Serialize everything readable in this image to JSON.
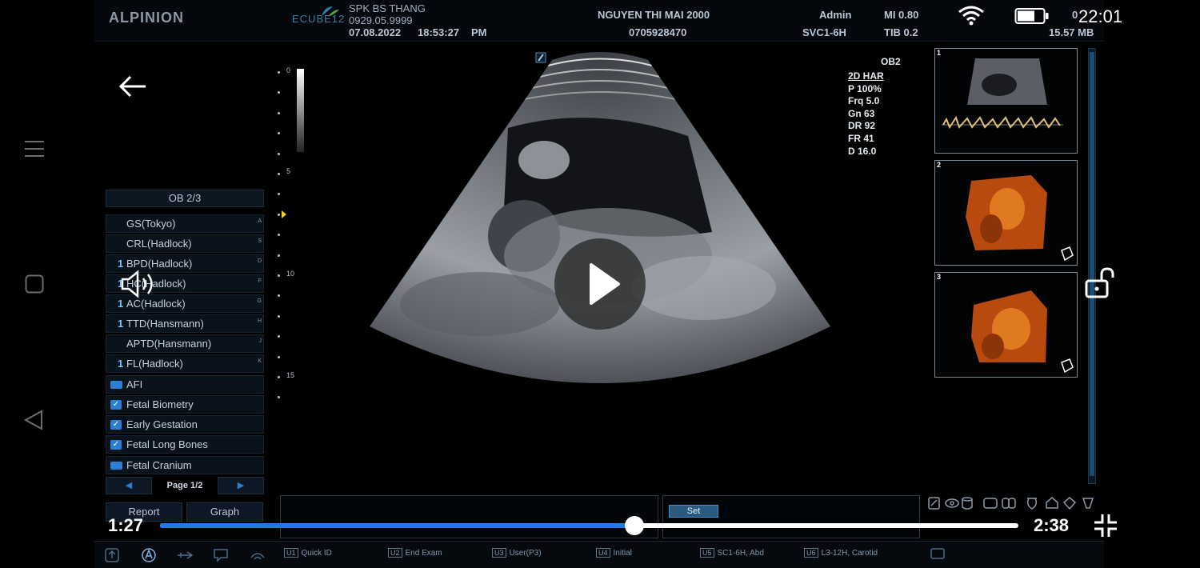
{
  "device": {
    "clock": "22:01"
  },
  "header": {
    "logo": "ALPINION",
    "ecube": "ECUBE12",
    "clinic": "SPK BS THANG",
    "phone": "0929.05.9999",
    "date": "07.08.2022",
    "time": "18:53:27",
    "ampm": "PM",
    "patient_name": "NGUYEN THI MAI 2000",
    "patient_id": "0705928470",
    "user": "Admin",
    "probe": "SVC1-6H",
    "mi": "MI 0.80",
    "tib": "TIB 0.2",
    "storage_top": "0",
    "storage": "15.57 MB"
  },
  "ob_panel": {
    "title": "OB 2/3",
    "measurements": [
      {
        "num": "",
        "label": "GS(Tokyo)",
        "key": "A"
      },
      {
        "num": "",
        "label": "CRL(Hadlock)",
        "key": "S"
      },
      {
        "num": "1",
        "label": "BPD(Hadlock)",
        "key": "D"
      },
      {
        "num": "1",
        "label": "HC(Hadlock)",
        "key": "F"
      },
      {
        "num": "1",
        "label": "AC(Hadlock)",
        "key": "G"
      },
      {
        "num": "1",
        "label": "TTD(Hansmann)",
        "key": "H"
      },
      {
        "num": "",
        "label": "APTD(Hansmann)",
        "key": "J"
      },
      {
        "num": "1",
        "label": "FL(Hadlock)",
        "key": "K"
      }
    ],
    "groups": [
      {
        "label": "AFI",
        "type": "folder"
      },
      {
        "label": "Fetal Biometry",
        "type": "check"
      },
      {
        "label": "Early Gestation",
        "type": "check"
      },
      {
        "label": "Fetal Long Bones",
        "type": "check"
      },
      {
        "label": "Fetal Cranium",
        "type": "folder"
      }
    ],
    "page": "Page 1/2",
    "report_label": "Report",
    "graph_label": "Graph"
  },
  "scale": {
    "labels": [
      "0",
      "5",
      "10",
      "15"
    ]
  },
  "image_params": {
    "preset": "OB2",
    "mode": "2D HAR",
    "power": "P 100%",
    "freq": "Frq 5.0",
    "gain": "Gn 63",
    "dr": "DR 92",
    "fr": "FR 41",
    "depth": "D 16.0"
  },
  "thumbnails": [
    "1",
    "2",
    "3"
  ],
  "bottom": {
    "set_label": "Set",
    "function_keys": [
      {
        "key": "U1",
        "label": "Quick ID"
      },
      {
        "key": "U2",
        "label": "End Exam"
      },
      {
        "key": "U3",
        "label": "User(P3)"
      },
      {
        "key": "U4",
        "label": "Initial"
      },
      {
        "key": "U5",
        "label": "SC1-6H, Abd"
      },
      {
        "key": "U6",
        "label": "L3-12H, Carotid"
      }
    ]
  },
  "video": {
    "current": "1:27",
    "duration": "2:38",
    "progress_fraction": 0.55
  },
  "colors": {
    "accent": "#1f7ae6",
    "ob_blue": "#2c7fd0"
  }
}
